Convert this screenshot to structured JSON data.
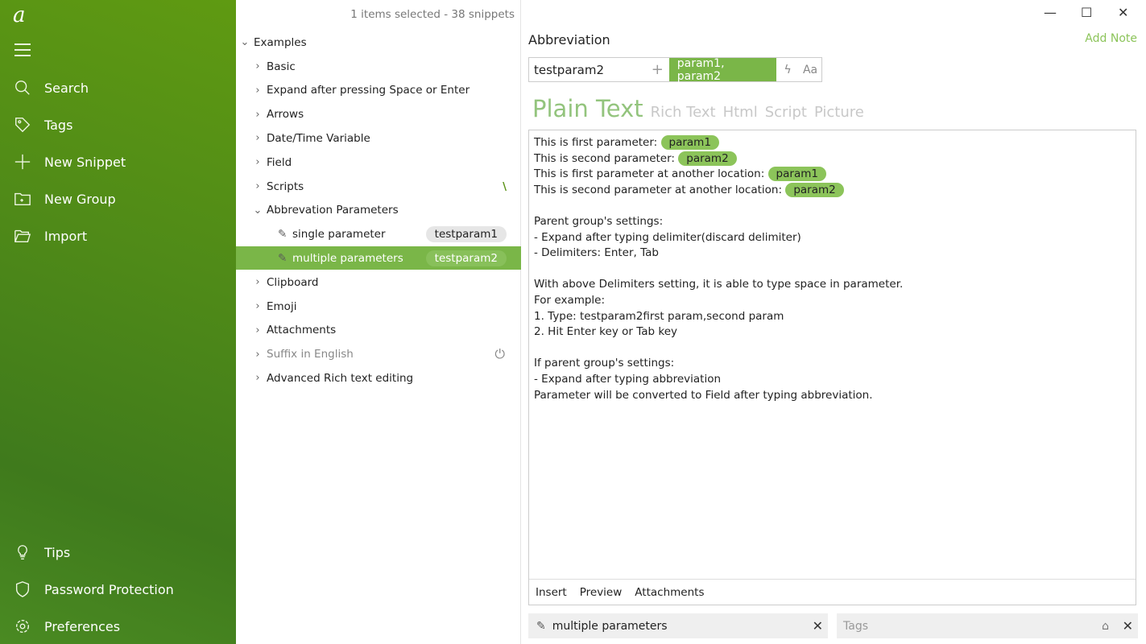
{
  "app": {
    "logo": "a"
  },
  "sidebar": {
    "items": [
      {
        "label": "Search",
        "icon": "search-icon"
      },
      {
        "label": "Tags",
        "icon": "tag-icon"
      },
      {
        "label": "New Snippet",
        "icon": "plus-icon"
      },
      {
        "label": "New Group",
        "icon": "folder-plus-icon"
      },
      {
        "label": "Import",
        "icon": "folder-open-icon"
      }
    ],
    "bottom": [
      {
        "label": "Tips",
        "icon": "lightbulb-icon"
      },
      {
        "label": "Password Protection",
        "icon": "shield-icon"
      },
      {
        "label": "Preferences",
        "icon": "gear-icon"
      }
    ]
  },
  "tree": {
    "status": "1 items selected - 38 snippets",
    "root": "Examples",
    "groups": [
      "Basic",
      "Expand after pressing Space or Enter",
      "Arrows",
      "Date/Time Variable",
      "Field",
      "Scripts",
      "Abbrevation Parameters"
    ],
    "children": [
      {
        "label": "single parameter",
        "abbr": "testparam1"
      },
      {
        "label": "multiple parameters",
        "abbr": "testparam2",
        "selected": true
      }
    ],
    "after": [
      "Clipboard",
      "Emoji",
      "Attachments",
      "Suffix in English",
      "Advanced Rich text editing"
    ],
    "scripts_mark": "\\"
  },
  "editor": {
    "abbr_label": "Abbreviation",
    "add_note": "Add Note",
    "abbr_value": "testparam2",
    "params": "param1, param2",
    "case_btn": "Aa",
    "formats": [
      "Plain Text",
      "Rich Text",
      "Html",
      "Script",
      "Picture"
    ],
    "lines": [
      {
        "t": "This is first parameter: ",
        "p": "param1"
      },
      {
        "t": "This is second parameter: ",
        "p": "param2"
      },
      {
        "t": "This is first parameter at another location: ",
        "p": "param1"
      },
      {
        "t": "This is second parameter at another location: ",
        "p": "param2"
      }
    ],
    "body": "\nParent group's settings:\n- Expand after typing delimiter(discard delimiter)\n- Delimiters: Enter, Tab\n\nWith above Delimiters setting, it is able to type space in parameter.\nFor example:\n1. Type: testparam2first param,second param\n2. Hit Enter key or Tab key\n\nIf parent group's settings:\n- Expand after typing abbreviation\nParameter will be converted to Field after typing abbreviation.",
    "tabs": [
      "Insert",
      "Preview",
      "Attachments"
    ],
    "name": "multiple parameters",
    "tags_placeholder": "Tags"
  },
  "colors": {
    "accent": "#7ab648",
    "sidebar": "#4f8a18"
  }
}
